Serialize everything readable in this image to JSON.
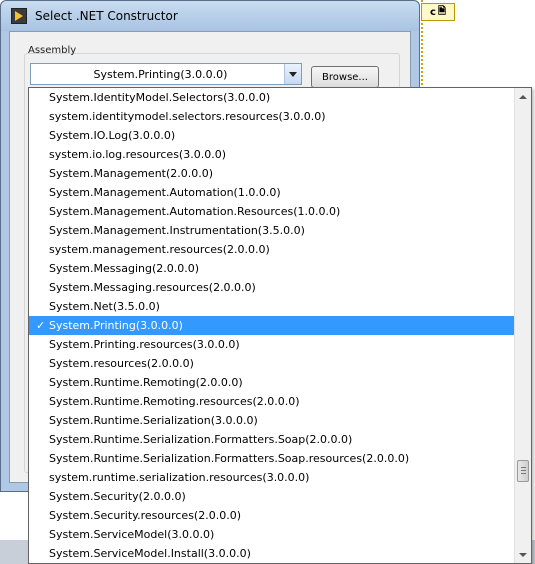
{
  "window": {
    "title": "Select .NET Constructor",
    "icon": "labview-icon"
  },
  "assembly": {
    "group_label": "Assembly",
    "selected_value": "System.Printing(3.0.0.0)",
    "browse_label": "Browse..."
  },
  "background": {
    "node_label": "c"
  },
  "dropdown": {
    "selected_index": 12,
    "check_mark": "✓",
    "items": [
      "System.IdentityModel.Selectors(3.0.0.0)",
      "system.identitymodel.selectors.resources(3.0.0.0)",
      "System.IO.Log(3.0.0.0)",
      "system.io.log.resources(3.0.0.0)",
      "System.Management(2.0.0.0)",
      "System.Management.Automation(1.0.0.0)",
      "System.Management.Automation.Resources(1.0.0.0)",
      "System.Management.Instrumentation(3.5.0.0)",
      "system.management.resources(2.0.0.0)",
      "System.Messaging(2.0.0.0)",
      "System.Messaging.resources(2.0.0.0)",
      "System.Net(3.5.0.0)",
      "System.Printing(3.0.0.0)",
      "System.Printing.resources(3.0.0.0)",
      "System.resources(2.0.0.0)",
      "System.Runtime.Remoting(2.0.0.0)",
      "System.Runtime.Remoting.resources(2.0.0.0)",
      "System.Runtime.Serialization(3.0.0.0)",
      "System.Runtime.Serialization.Formatters.Soap(2.0.0.0)",
      "System.Runtime.Serialization.Formatters.Soap.resources(2.0.0.0)",
      "system.runtime.serialization.resources(3.0.0.0)",
      "System.Security(2.0.0.0)",
      "System.Security.resources(2.0.0.0)",
      "System.ServiceModel(3.0.0.0)",
      "System.ServiceModel.Install(3.0.0.0)"
    ]
  }
}
